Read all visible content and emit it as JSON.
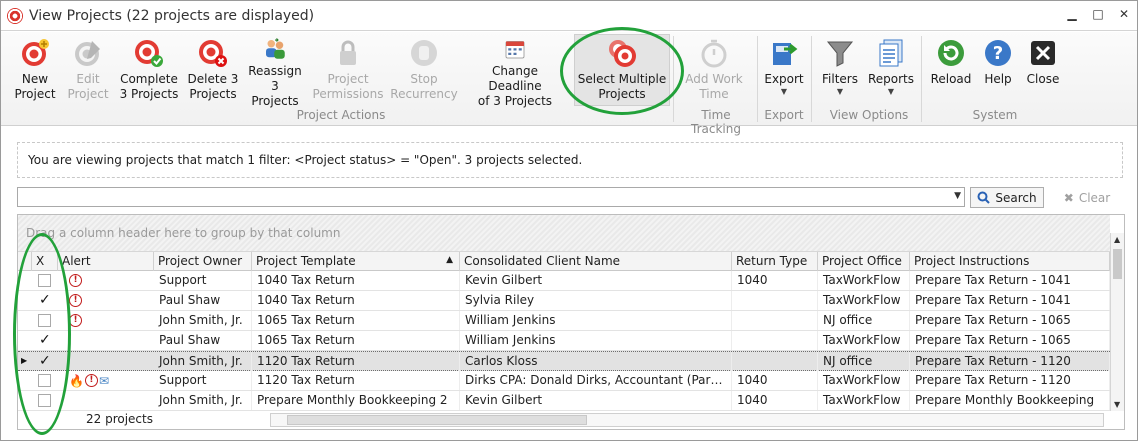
{
  "window": {
    "title": "View Projects (22 projects are displayed)"
  },
  "window_buttons": {
    "minimize": "▁",
    "maximize": "□",
    "close": "✕"
  },
  "ribbon": {
    "new_project": "New\nProject",
    "edit_project": "Edit\nProject",
    "complete": "Complete\n3 Projects",
    "delete": "Delete 3\nProjects",
    "reassign": "Reassign\n3 Projects",
    "permissions": "Project\nPermissions",
    "stop_recurrency": "Stop\nRecurrency",
    "change_deadline": "Change Deadline\nof 3 Projects",
    "select_multiple": "Select Multiple\nProjects",
    "add_work_time": "Add Work\nTime",
    "export": "Export",
    "filters": "Filters",
    "reports": "Reports",
    "reload": "Reload",
    "help": "Help",
    "close": "Close",
    "groups": {
      "project_actions": "Project Actions",
      "time_tracking": "Time Tracking",
      "export": "Export",
      "view_options": "View Options",
      "system": "System"
    }
  },
  "info_text": "You are viewing projects that match 1 filter: <Project status> = \"Open\". 3 projects selected.",
  "search": {
    "value": "",
    "button": "Search",
    "clear": "Clear"
  },
  "grid": {
    "group_hint": "Drag a column header here to group by that column",
    "columns": [
      "X",
      "Alert",
      "Project Owner",
      "Project Template",
      "Consolidated Client Name",
      "Return Type",
      "Project Office",
      "Project Instructions"
    ],
    "rows": [
      {
        "checked": false,
        "alerts": [
          "alert"
        ],
        "owner": "Support",
        "template": "1040 Tax Return",
        "client": "Kevin Gilbert",
        "return_type": "1040",
        "office": "TaxWorkFlow",
        "instructions": "Prepare Tax Return - 1041"
      },
      {
        "checked": true,
        "alerts": [
          "alert"
        ],
        "owner": "Paul Shaw",
        "template": "1040 Tax Return",
        "client": "Sylvia Riley",
        "return_type": "",
        "office": "TaxWorkFlow",
        "instructions": "Prepare Tax Return - 1041"
      },
      {
        "checked": false,
        "alerts": [
          "alert"
        ],
        "owner": "John Smith, Jr.",
        "template": "1065 Tax Return",
        "client": "William Jenkins",
        "return_type": "",
        "office": "NJ office",
        "instructions": "Prepare Tax Return - 1065"
      },
      {
        "checked": true,
        "alerts": [],
        "owner": "Paul Shaw",
        "template": "1065 Tax Return",
        "client": "William Jenkins",
        "return_type": "",
        "office": "TaxWorkFlow",
        "instructions": "Prepare Tax Return - 1065"
      },
      {
        "checked": true,
        "alerts": [],
        "owner": "John Smith, Jr.",
        "template": "1120 Tax Return",
        "client": "Carlos Kloss",
        "return_type": "",
        "office": "NJ office",
        "instructions": "Prepare Tax Return - 1120",
        "selected": true
      },
      {
        "checked": false,
        "alerts": [
          "fire",
          "alert",
          "mail"
        ],
        "owner": "Support",
        "template": "1120 Tax Return",
        "client": "Dirks CPA: Donald Dirks, Accountant (Partner...",
        "return_type": "1040",
        "office": "TaxWorkFlow",
        "instructions": "Prepare Tax Return - 1120"
      },
      {
        "checked": false,
        "alerts": [],
        "owner": "John Smith, Jr.",
        "template": "Prepare Monthly Bookkeeping 2",
        "client": "Kevin Gilbert",
        "return_type": "1040",
        "office": "TaxWorkFlow",
        "instructions": "Prepare Monthly Bookkeeping"
      }
    ],
    "count": "22 projects",
    "sort_column": "Project Template"
  }
}
